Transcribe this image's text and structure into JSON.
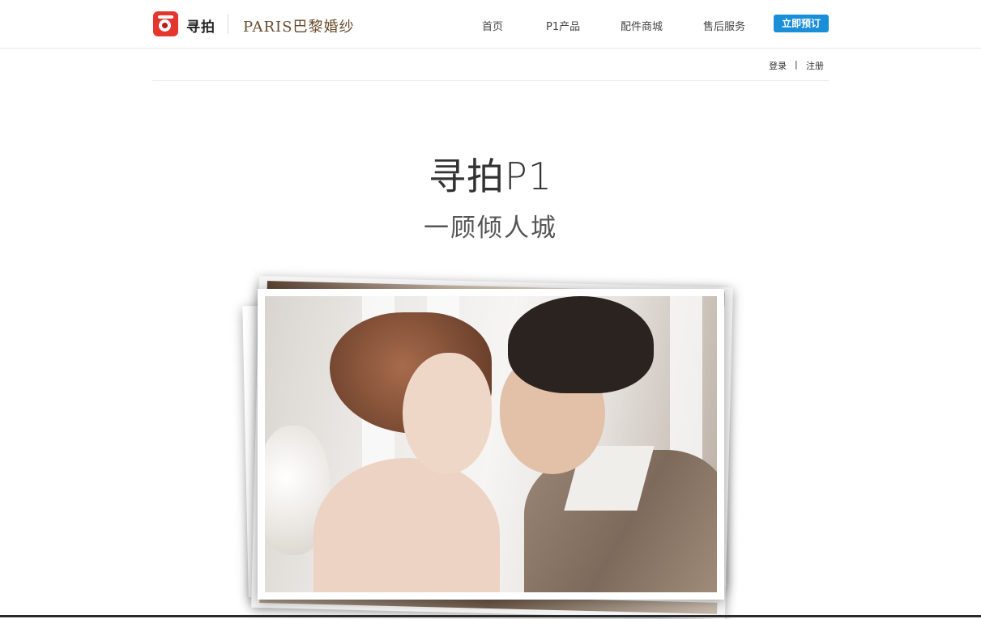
{
  "header": {
    "logo_text": "寻拍",
    "partner_logo": "PARIS巴黎婚纱",
    "nav": [
      "首页",
      "P1产品",
      "配件商城",
      "售后服务"
    ],
    "book_button": "立即预订"
  },
  "auth": {
    "login": "登录",
    "separator": "|",
    "register": "注册"
  },
  "hero": {
    "title": "寻拍P1",
    "subtitle": "一顾倾人城"
  },
  "icons": {
    "logo": "camera-logo-icon"
  },
  "colors": {
    "accent": "#1a8ed6",
    "logo_red": "#e5362e",
    "partner_brown": "#6b4a2b"
  }
}
